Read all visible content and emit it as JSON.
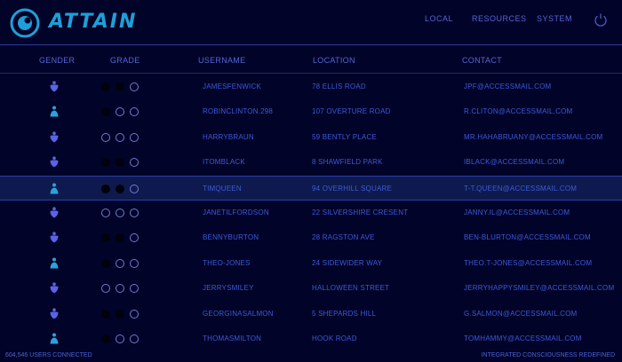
{
  "header": {
    "brand": "ATTAIN",
    "nav": [
      "LOCAL",
      "RESOURCES",
      "SYSTEM"
    ],
    "accent": "#1e9fd8"
  },
  "columns": [
    "GENDER",
    "GRADE",
    "USERNAME",
    "LOCATION",
    "CONTACT"
  ],
  "rows": [
    {
      "gender": "female",
      "grade": 2,
      "username": "JAMESFENWICK",
      "location": "78 ELLIS ROAD",
      "contact": "JPF@ACCESSMAIL.COM"
    },
    {
      "gender": "male",
      "grade": 1,
      "username": "ROBINCLINTON.298",
      "location": "107 OVERTURE ROAD",
      "contact": "R.CLITON@ACCESSMAIL.COM"
    },
    {
      "gender": "female",
      "grade": 0,
      "username": "HARRYBRAUN",
      "location": "59 BENTLY PLACE",
      "contact": "MR.HAHABRUANY@ACCESSMAIL.COM"
    },
    {
      "gender": "female",
      "grade": 2,
      "username": "ITOMBLACK",
      "location": "8 SHAWFIELD PARK",
      "contact": "IBLACK@ACCESSMAIL.COM"
    },
    {
      "gender": "male",
      "grade": 2,
      "username": "TIMQUEEN",
      "location": "94 OVERHILL SQUARE",
      "contact": "T-T.QUEEN@ACCESSMAIL.COM",
      "selected": true
    },
    {
      "gender": "female",
      "grade": 0,
      "username": "JANETILFORDSON",
      "location": "22 SILVERSHIRE CRESENT",
      "contact": "JANNY.IL@ACCESSMAIL.COM"
    },
    {
      "gender": "female",
      "grade": 2,
      "username": "BENNYBURTON",
      "location": "28 RAGSTON AVE",
      "contact": "BEN-BLURTON@ACCESSMAIL.COM"
    },
    {
      "gender": "male",
      "grade": 1,
      "username": "THEO-JONES",
      "location": "24 SIDEWIDER WAY",
      "contact": "THEO.T-JONES@ACCESSMAIL.COM"
    },
    {
      "gender": "female",
      "grade": 0,
      "username": "JERRYSMILEY",
      "location": "HALLOWEEN STREET",
      "contact": "JERRYHAPPYSMILEY@ACCESSMAIL.COM"
    },
    {
      "gender": "female",
      "grade": 2,
      "username": "GEORGINASALMON",
      "location": "5 SHEPARDS HILL",
      "contact": "G.SALMON@ACCESSMAIL.COM"
    },
    {
      "gender": "male",
      "grade": 1,
      "username": "THOMASMILTON",
      "location": "HOOK ROAD",
      "contact": "TOMHAMMY@ACCESSMAIL.COM"
    }
  ],
  "footer": {
    "left": "604,546 USERS CONNECTED",
    "right": "INTEGRATED CONSCIOUSNESS REDEFINED"
  },
  "colors": {
    "female": "#5b63e6",
    "male": "#2aa3dc"
  }
}
